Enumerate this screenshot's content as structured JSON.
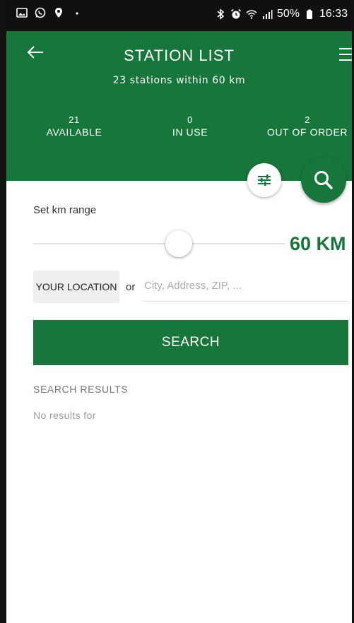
{
  "status_bar": {
    "battery_percent": "50%",
    "time": "16:33",
    "left_icons": [
      "image-icon",
      "whatsapp-icon",
      "location-pin-icon",
      "dot-icon"
    ],
    "right_icons": [
      "bluetooth-icon",
      "alarm-icon",
      "wifi-icon",
      "signal-icon",
      "battery-icon"
    ]
  },
  "header": {
    "title": "STATION LIST",
    "subtitle": "23 stations within 60 km",
    "back_icon": "arrow-left-icon",
    "menu_icon": "hamburger-menu-icon",
    "stats": [
      {
        "count": "21",
        "label": "AVAILABLE"
      },
      {
        "count": "0",
        "label": "IN USE"
      },
      {
        "count": "2",
        "label": "OUT OF ORDER"
      }
    ],
    "color": "#17773a"
  },
  "filter_button": {
    "icon": "sliders-icon"
  },
  "search_fab": {
    "icon": "search-icon"
  },
  "range": {
    "label": "Set km range",
    "value_label": "60 KM",
    "value_km": 60,
    "slider_fraction": 0.6
  },
  "location": {
    "button_label": "YOUR LOCATION",
    "or_text": "or",
    "placeholder": "City, Address, ZIP, ..."
  },
  "search": {
    "button_label": "SEARCH"
  },
  "results": {
    "heading": "SEARCH RESULTS",
    "empty_text": "No results for"
  }
}
